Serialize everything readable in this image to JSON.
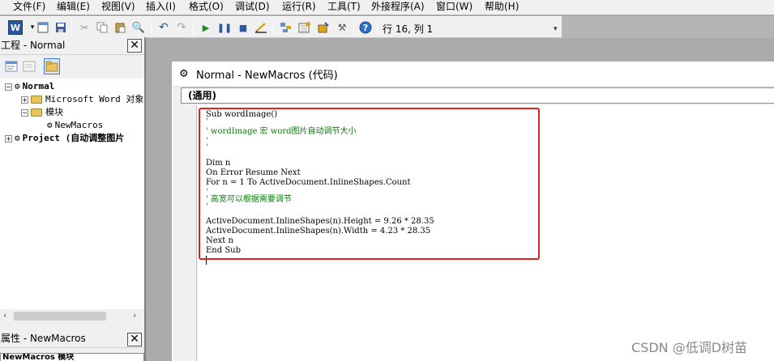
{
  "menubar": {
    "items": [
      "文件(F)",
      "编辑(E)",
      "视图(V)",
      "插入(I)",
      "格式(O)",
      "调试(D)",
      "运行(R)",
      "工具(T)",
      "外接程序(A)",
      "窗口(W)",
      "帮助(H)"
    ]
  },
  "toolbar": {
    "cursor_position": "行 16, 列 1"
  },
  "project_panel": {
    "title": "工程 - Normal",
    "tree": {
      "normal": "Normal",
      "word_objects": "Microsoft Word 对象",
      "modules": "模块",
      "newmacros": "NewMacros",
      "project": "Project (自动调整图片"
    }
  },
  "properties_panel": {
    "title": "属性 - NewMacros",
    "selected_object": "NewMacros 模块"
  },
  "code_window": {
    "title": "Normal - NewMacros (代码)",
    "object_combo": "(通用)",
    "lines": [
      {
        "text": "Sub wordImage()",
        "type": "code"
      },
      {
        "text": "'",
        "type": "comment"
      },
      {
        "text": "' wordImage 宏 word图片自动调节大小",
        "type": "comment"
      },
      {
        "text": "'",
        "type": "comment"
      },
      {
        "text": "'",
        "type": "comment"
      },
      {
        "text": "Dim n",
        "type": "code"
      },
      {
        "text": "On Error Resume Next",
        "type": "code"
      },
      {
        "text": "For n = 1 To ActiveDocument.InlineShapes.Count",
        "type": "code"
      },
      {
        "text": "'",
        "type": "comment"
      },
      {
        "text": "' 高宽可以根据需要调节",
        "type": "comment"
      },
      {
        "text": "'",
        "type": "comment"
      },
      {
        "text": "ActiveDocument.InlineShapes(n).Height = 9.26 * 28.35",
        "type": "code"
      },
      {
        "text": "ActiveDocument.InlineShapes(n).Width = 4.23 * 28.35",
        "type": "code"
      },
      {
        "text": "Next n",
        "type": "code"
      },
      {
        "text": "End Sub",
        "type": "code"
      }
    ]
  },
  "watermark": "CSDN @低调D树苗",
  "colors": {
    "comment": "#0a7d0a",
    "highlight_border": "#e12020",
    "workspace_bg": "#ababab"
  }
}
